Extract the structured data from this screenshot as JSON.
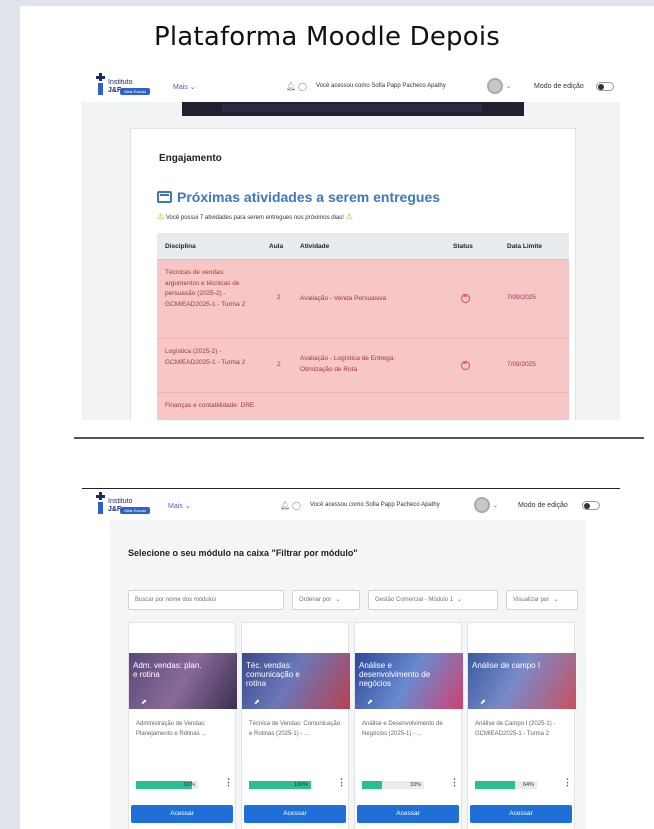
{
  "slide": {
    "title": "Plataforma Moodle Depois"
  },
  "header": {
    "logo_line1": "Instituto",
    "logo_line2": "J&F",
    "logo_pill": "Mais Escola",
    "menu": "Mais",
    "user_message": "Você acessou como Sofia Papp Pacheco Apathy",
    "edit_mode": "Modo de edição"
  },
  "screen1": {
    "section": "Engajamento",
    "title": "Próximas atividades a serem entregues",
    "warning": "Você possui 7 atividades para serem entregues nos próximos dias!",
    "columns": [
      "Disciplina",
      "Aula",
      "Atividade",
      "Status",
      "Data Limite"
    ],
    "rows": [
      {
        "disciplina": "Técnicas de vendas: argumentos e técnicas de persuasão (2025-2) - GCMIEAD2025-1 - Turma 2",
        "aula": "2",
        "atividade": "Avaliação - Venda Persuasiva",
        "data": "7/09/2025"
      },
      {
        "disciplina": "Logística (2025-2) - GCMIEAD2025-1 - Turma 2",
        "aula": "2",
        "atividade": "Avaliação - Logística de Entrega: Otimização de Rota",
        "data": "7/09/2025"
      },
      {
        "disciplina": "Finanças e contabilidade: DRE",
        "aula": "",
        "atividade": "",
        "data": ""
      }
    ]
  },
  "screen2": {
    "title": "Selecione o seu módulo na caixa \"Filtrar por módulo\"",
    "search_placeholder": "Buscar por nome dos módulos",
    "sort_label": "Ordenar por",
    "module_filter": "Gestão Comercial - Módulo 1",
    "view_label": "Visualizar por",
    "cards": [
      {
        "image_label": "Adm. vendas: plan. e rotina",
        "name": "Administração de Vendas: Planejamento e Rotinas ...",
        "progress": 91,
        "progress_label": "91%",
        "button": "Acessar"
      },
      {
        "image_label": "Téc. vendas: comunicação e rotina",
        "name": "Técnica de Vendas: Comunicação e Rotinas (2025-1) - ...",
        "progress": 100,
        "progress_label": "100%",
        "button": "Acessar"
      },
      {
        "image_label": "Análise e desenvolvimento de negócios",
        "name": "Análise e Desenvolvimento de Negócios (2025-1) - ...",
        "progress": 33,
        "progress_label": "33%",
        "button": "Acessar"
      },
      {
        "image_label": "Análise de campo I",
        "name": "Análise de Campo I (2025-1) - GCMIEAD2025-1 - Turma 2",
        "progress": 64,
        "progress_label": "64%",
        "button": "Acessar"
      }
    ]
  },
  "colors": {
    "accent": "#3b78c2",
    "button": "#1f6fd8",
    "progress": "#2bbf8f",
    "overdue_row": "#f7c6c7"
  }
}
